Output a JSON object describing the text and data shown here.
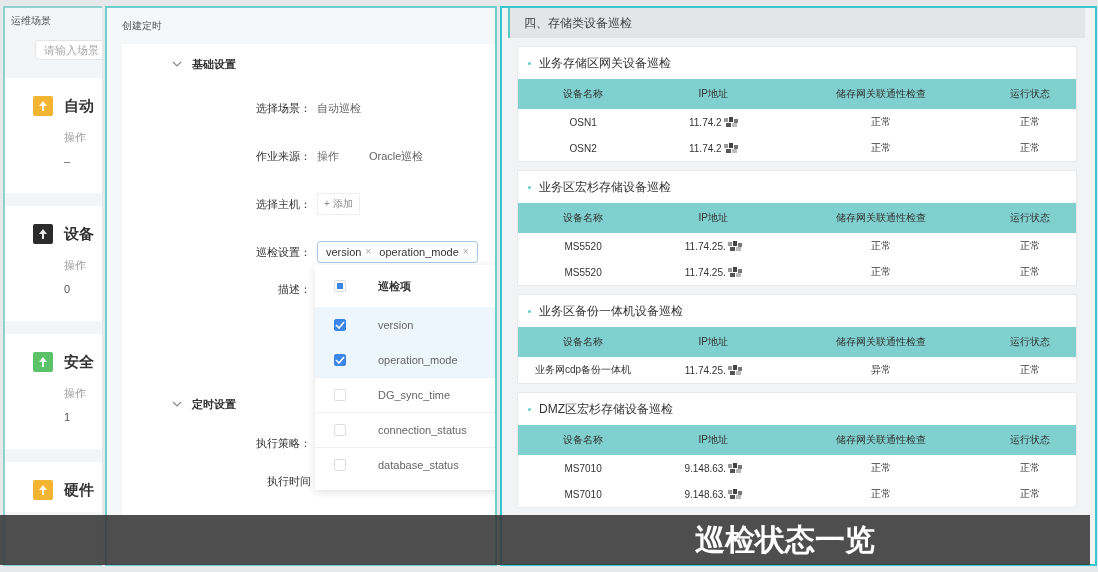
{
  "scenes_panel": {
    "title": "运维场景",
    "search": {
      "placeholder": "请输入场景"
    },
    "cards": [
      {
        "title": "自动",
        "color": "#f2b531",
        "label": "操作",
        "value": "–"
      },
      {
        "title": "设备",
        "color": "#2b2b2b",
        "label": "操作",
        "value": "0"
      },
      {
        "title": "安全",
        "color": "#5cc26a",
        "label": "操作",
        "value": "1"
      },
      {
        "title": "硬件",
        "color": "#f2b531"
      }
    ]
  },
  "form_panel": {
    "title": "创建定时",
    "sections": [
      {
        "title": "基础设置",
        "expanded": true,
        "fields": [
          {
            "kind": "text",
            "label": "选择场景：",
            "values": [
              "自动巡检"
            ]
          },
          {
            "kind": "text",
            "label": "作业来源：",
            "values": [
              "操作",
              "Oracle巡检"
            ]
          },
          {
            "kind": "add",
            "label": "选择主机：",
            "button": "+ 添加"
          },
          {
            "kind": "tags",
            "label": "巡检设置：",
            "tags": [
              {
                "text": "version",
                "close": "×"
              },
              {
                "text": "operation_mode",
                "close": "×"
              }
            ]
          },
          {
            "kind": "empty",
            "label": "描述："
          }
        ]
      },
      {
        "title": "定时设置",
        "expanded": true,
        "fields": [
          {
            "kind": "empty",
            "label": "执行策略："
          },
          {
            "kind": "empty",
            "label": "执行时间"
          }
        ]
      }
    ],
    "dropdown": {
      "header": "巡检项",
      "indeterminate": true,
      "items": [
        {
          "label": "version",
          "checked": true
        },
        {
          "label": "operation_mode",
          "checked": true
        },
        {
          "label": "DG_sync_time",
          "checked": false
        },
        {
          "label": "connection_status",
          "checked": false
        },
        {
          "label": "database_status",
          "checked": false
        }
      ]
    }
  },
  "report_panel": {
    "title": "四、存储类设备巡检",
    "cards": [
      {
        "title": "业务存储区网关设备巡检",
        "columns": [
          "设备名称",
          "IP地址",
          "储存网关联通性检查",
          "运行状态"
        ],
        "rows": [
          [
            "OSN1",
            "11.74.2",
            "正常",
            "正常"
          ],
          [
            "OSN2",
            "11.74.2",
            "正常",
            "正常"
          ]
        ]
      },
      {
        "title": "业务区宏杉存储设备巡检",
        "columns": [
          "设备名称",
          "IP地址",
          "储存网关联通性检查",
          "运行状态"
        ],
        "rows": [
          [
            "MS5520",
            "11.74.25.",
            "正常",
            "正常"
          ],
          [
            "MS5520",
            "11.74.25.",
            "正常",
            "正常"
          ]
        ]
      },
      {
        "title": "业务区备份一体机设备巡检",
        "columns": [
          "设备名称",
          "IP地址",
          "储存网关联通性检查",
          "运行状态"
        ],
        "rows": [
          [
            "业务网cdp备份一体机",
            "11.74.25.",
            "异常",
            "正常"
          ]
        ]
      },
      {
        "title": "DMZ区宏杉存储设备巡检",
        "columns": [
          "设备名称",
          "IP地址",
          "储存网关联通性检查",
          "运行状态"
        ],
        "rows": [
          [
            "MS7010",
            "9.148.63.",
            "正常",
            "正常"
          ],
          [
            "MS7010",
            "9.148.63.",
            "正常",
            "正常"
          ]
        ]
      }
    ]
  },
  "caption": {
    "text": "巡检状态一览"
  }
}
